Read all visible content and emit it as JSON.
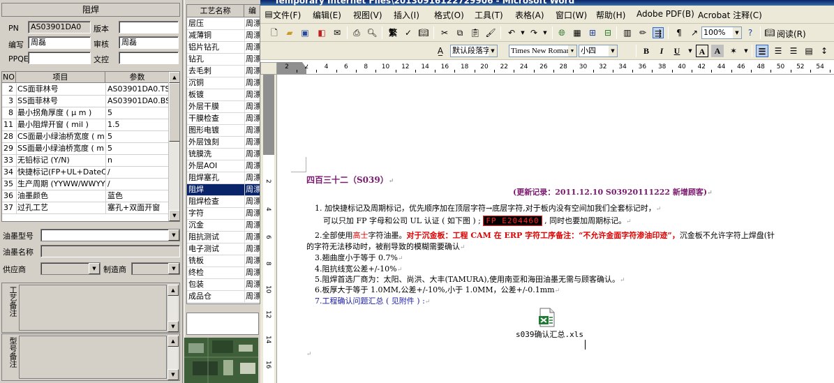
{
  "left_panel": {
    "title": "阻焊",
    "pn_label": "PN",
    "pn_value": "AS03901DA0",
    "version_label": "版本",
    "version_value": "",
    "editor_label": "编写",
    "editor_value": "周磊",
    "reviewer_label": "审核",
    "reviewer_value": "周磊",
    "ppqe_label": "PPQE",
    "ppqe_value": "",
    "wenkong_label": "文控",
    "wenkong_value": "",
    "grid": {
      "headers": [
        "NO",
        "项目",
        "参数"
      ],
      "rows": [
        {
          "no": "2",
          "item": "CS面菲林号",
          "value": "AS03901DA0.TS"
        },
        {
          "no": "3",
          "item": "SS面菲林号",
          "value": "AS03901DA0.BS"
        },
        {
          "no": "8",
          "item": "最小拐角厚度 ( μ m )",
          "value": "5"
        },
        {
          "no": "11",
          "item": "最小阻焊开窗 ( mil )",
          "value": "1.5"
        },
        {
          "no": "28",
          "item": "CS面最小绿油桥宽度 ( m",
          "value": "5"
        },
        {
          "no": "29",
          "item": "SS面最小绿油桥宽度 ( m",
          "value": "5"
        },
        {
          "no": "33",
          "item": "无铅标记 (Y/N)",
          "value": "n"
        },
        {
          "no": "34",
          "item": "快捷标记(FP+UL+DateCo",
          "value": "/"
        },
        {
          "no": "35",
          "item": "生产周期 (YYWW/WWYY)",
          "value": "/"
        },
        {
          "no": "36",
          "item": "油墨颜色",
          "value": "蓝色"
        },
        {
          "no": "37",
          "item": "过孔工艺",
          "value": "塞孔+双面开窗"
        }
      ]
    },
    "ink_type_label": "油墨型号",
    "ink_type_value": "",
    "ink_name_label": "油墨名称",
    "ink_name_value": "",
    "supplier_label": "供应商",
    "supplier_value": "",
    "maker_label": "制造商",
    "maker_value": "",
    "process_note_label": "工艺备注",
    "model_note_label": "型号备注"
  },
  "process_list": {
    "headers": [
      "工艺名称",
      "编"
    ],
    "rows": [
      {
        "name": "层压",
        "cat": "周漂"
      },
      {
        "name": "减薄铜",
        "cat": "周漂"
      },
      {
        "name": "铝片钻孔",
        "cat": "周漂"
      },
      {
        "name": "钻孔",
        "cat": "周漂"
      },
      {
        "name": "去毛刺",
        "cat": "周漂"
      },
      {
        "name": "沉铜",
        "cat": "周漂"
      },
      {
        "name": "板镀",
        "cat": "周漂"
      },
      {
        "name": "外层干膜",
        "cat": "周漂"
      },
      {
        "name": "干膜检查",
        "cat": "周漂"
      },
      {
        "name": "图形电镀",
        "cat": "周漂"
      },
      {
        "name": "外层蚀刻",
        "cat": "周漂"
      },
      {
        "name": "铳膜洗",
        "cat": "周漂"
      },
      {
        "name": "外层AOI",
        "cat": "周漂"
      },
      {
        "name": "阻焊塞孔",
        "cat": "周漂"
      },
      {
        "name": "阻焊",
        "cat": "周漂",
        "selected": true
      },
      {
        "name": "阻焊检查",
        "cat": "周漂"
      },
      {
        "name": "字符",
        "cat": "周漂"
      },
      {
        "name": "沉金",
        "cat": "周漂"
      },
      {
        "name": "阻抗测试",
        "cat": "周漂"
      },
      {
        "name": "电子测试",
        "cat": "周漂"
      },
      {
        "name": "铣板",
        "cat": "周漂"
      },
      {
        "name": "终检",
        "cat": "周漂"
      },
      {
        "name": "包装",
        "cat": "周漂"
      },
      {
        "name": "成品仓",
        "cat": "周漂"
      }
    ]
  },
  "word": {
    "title": "Temporary Internet Files\\20130916122729906 - Microsoft Word",
    "menus": [
      "文件(F)",
      "编辑(E)",
      "视图(V)",
      "插入(I)",
      "格式(O)",
      "工具(T)",
      "表格(A)",
      "窗口(W)",
      "帮助(H)",
      "Adobe PDF(B)",
      "Acrobat 注释(C)"
    ],
    "zoom": "100%",
    "read_label": "阅读(R)",
    "style_value": "默认段落字体",
    "font_value": "Times New Roman",
    "size_value": "小四",
    "ruler_numbers": [
      "2",
      "2",
      "4",
      "6",
      "8",
      "10",
      "12",
      "14",
      "16",
      "18",
      "20",
      "22",
      "24",
      "26",
      "28",
      "30",
      "32",
      "34",
      "36",
      "38",
      "40",
      "42",
      "44",
      "46",
      "48",
      "50",
      "52",
      "54"
    ],
    "doc": {
      "heading": "四百三十二（S039）",
      "update_note": "(更新记录：2011.12.10       S03920111222       新增顾客)",
      "line1": "1. 加快捷标记及周期标记，优先顺序加在顶层字符→底层字符,对于板内没有空间加我们全套标记时，",
      "line2_pre": "可以只加 FP 字母和公司 UL 认证 ( 如下图 ) ; ",
      "code_box": "FP E204460",
      "line2_post": " , 同时也要加周期标记。",
      "line3_pre": "2.全部使用",
      "line3_brand": "高士",
      "line3_mid": "字符油墨。",
      "line3_red": "对于沉金板：工程 CAM 在 ERP 字符工序备注：“不允许金面字符渗油印迹”，",
      "line3_post": "沉金板不允许字符上焊盘(针",
      "line4": "的字符无法移动时，被削导致的模糊需要确认",
      "line5": "3.翘曲度小于等于 0.7%",
      "line6": "4.阻抗线宽公差+/-10%",
      "line7": "5.阻焊首选厂商为：太阳、尚洪、大丰(TAMURA),使用南亚和海田油墨无需与顾客确认。",
      "line8": "6.板厚大于等于 1.0MM,公差+/-10%,小于 1.0MM，公差+/-0.1mm",
      "line9": "7.工程确认问题汇总 ( 见附件 ) :",
      "attachment": "s039确认汇总.xls",
      "para_mark": "↵"
    }
  },
  "colors": {
    "selection": "#0a246a",
    "purple": "#7a1a6e",
    "red": "#e00000",
    "blue": "#1a1aa0"
  }
}
